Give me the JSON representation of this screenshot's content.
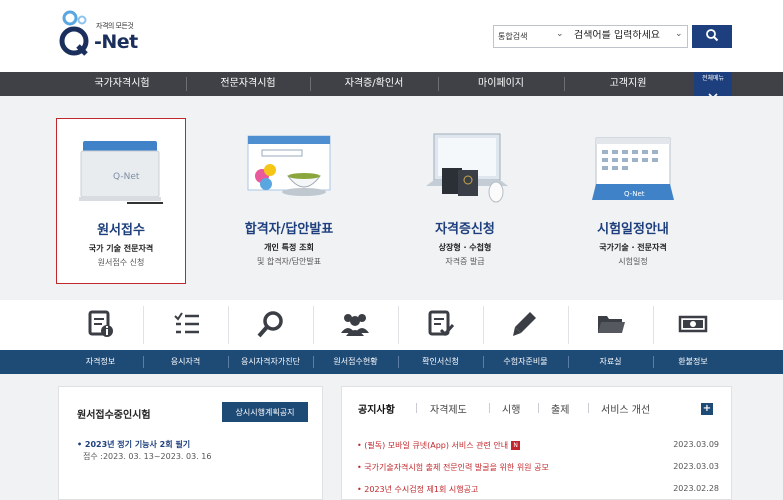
{
  "header": {
    "logo_tagline": "자격의 모든것",
    "logo_word": "-Net",
    "search_scope": "통합검색",
    "search_placeholder": "검색어를 입력하세요"
  },
  "gnb": {
    "items": [
      "국가자격시험",
      "전문자격시험",
      "자격증/확인서",
      "마이페이지",
      "고객지원"
    ],
    "all_menu_label": "전체메뉴"
  },
  "cards": [
    {
      "title": "원서접수",
      "sub1": "국가 기술 전문자격",
      "sub2": "원서접수 신청",
      "icon": "folder-illustration"
    },
    {
      "title": "합격자/답안발표",
      "sub1": "개인 특정 조회",
      "sub2": "및 합격자/답안발표",
      "icon": "browser-tea-illustration"
    },
    {
      "title": "자격증신청",
      "sub1": "상장형 · 수첩형",
      "sub2": "자격증 발급",
      "icon": "laptop-passport-illustration"
    },
    {
      "title": "시험일정안내",
      "sub1": "국가기술 · 전문자격",
      "sub2": "시험일정",
      "icon": "calendar-illustration"
    }
  ],
  "quick_menu": {
    "icons": [
      "document-info-icon",
      "checklist-icon",
      "search-icon",
      "group-icon",
      "document-check-icon",
      "pencil-icon",
      "folder-icon",
      "money-icon"
    ],
    "labels": [
      "자격정보",
      "응시자격",
      "응시자격자가진단",
      "원서접수현황",
      "확인서신청",
      "수험자준비물",
      "자료실",
      "환불정보"
    ]
  },
  "exam_box": {
    "title": "원서접수중인시험",
    "button": "상시시행계획공지",
    "item_title": "• 2023년 정기 기능사 2회 필기",
    "item_period": "접수 :2023. 03. 13~2023. 03. 16"
  },
  "notice": {
    "tabs": [
      "공지사항",
      "자격제도",
      "시행",
      "출제",
      "서비스 개선"
    ],
    "plus": "+",
    "new_badge": "N",
    "items": [
      {
        "title": "• (필독) 모바일 큐넷(App) 서비스 관련 안내",
        "date": "2023.03.09"
      },
      {
        "title": "• 국가기술자격시험 출제 전문인력 발굴을 위한 위원 공모",
        "date": "2023.03.03"
      },
      {
        "title": "• 2023년 수시검정 제1회 시행공고",
        "date": "2023.02.28"
      }
    ]
  },
  "colors": {
    "navy": "#1e3f7d",
    "gnb_bg": "#3f4146",
    "quick_bar": "#1e4a76",
    "accent_red": "#c0282d"
  }
}
